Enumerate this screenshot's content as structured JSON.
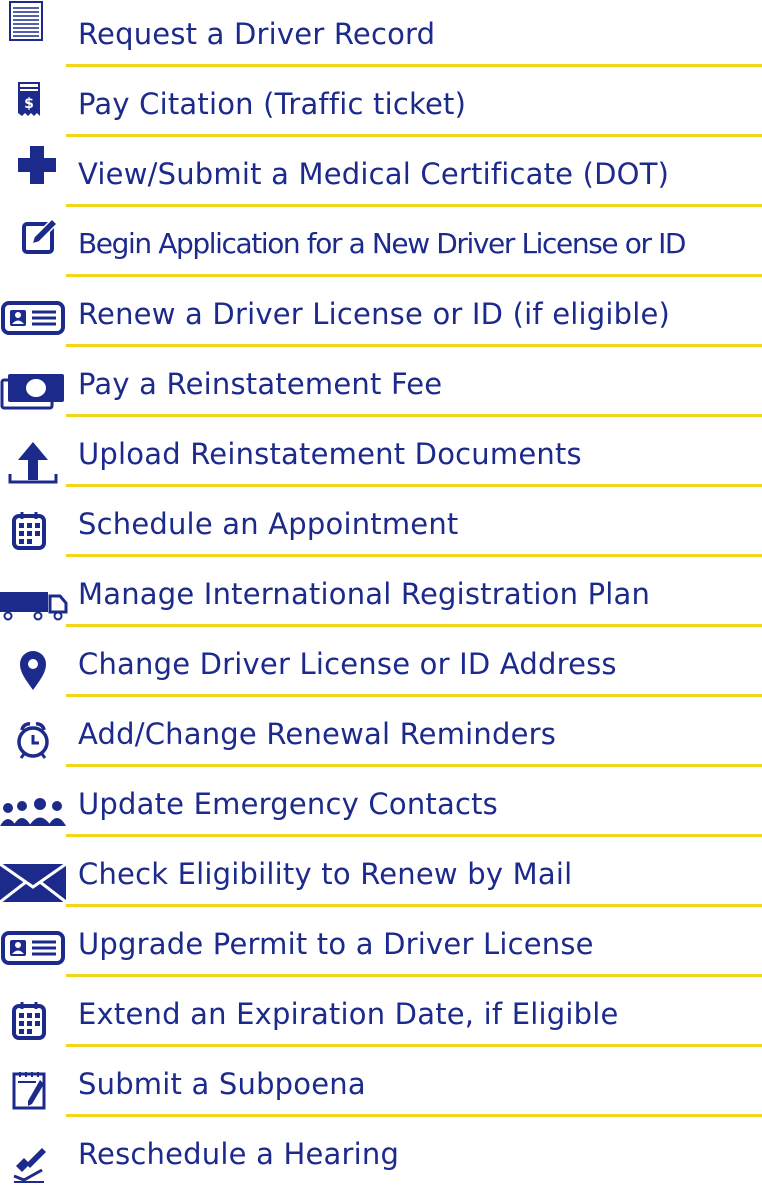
{
  "colors": {
    "text": "#1c2a8c",
    "icon": "#1c2a8c",
    "rule": "#f2d61a"
  },
  "items": [
    {
      "label": "Request a Driver Record",
      "icon": "document-lines-icon"
    },
    {
      "label": "Pay Citation (Traffic ticket)",
      "icon": "receipt-dollar-icon"
    },
    {
      "label": "View/Submit a Medical Certificate (DOT)",
      "icon": "medical-cross-icon"
    },
    {
      "label": "Begin Application for a New Driver License or ID",
      "icon": "edit-square-icon"
    },
    {
      "label": "Renew a Driver License or ID (if eligible)",
      "icon": "id-card-icon"
    },
    {
      "label": "Pay a Reinstatement Fee",
      "icon": "cash-bill-icon"
    },
    {
      "label": "Upload Reinstatement Documents",
      "icon": "upload-arrow-icon"
    },
    {
      "label": "Schedule an Appointment",
      "icon": "calendar-icon"
    },
    {
      "label": "Manage International Registration Plan",
      "icon": "truck-icon"
    },
    {
      "label": "Change Driver License or ID Address",
      "icon": "map-pin-icon"
    },
    {
      "label": "Add/Change Renewal Reminders",
      "icon": "alarm-clock-icon"
    },
    {
      "label": "Update Emergency Contacts",
      "icon": "people-group-icon"
    },
    {
      "label": "Check Eligibility to Renew by Mail",
      "icon": "envelope-icon"
    },
    {
      "label": "Upgrade Permit to a Driver License",
      "icon": "id-card-icon"
    },
    {
      "label": "Extend an Expiration Date, if Eligible",
      "icon": "calendar-icon"
    },
    {
      "label": "Submit a Subpoena",
      "icon": "notepad-pencil-icon"
    },
    {
      "label": "Reschedule a Hearing",
      "icon": "gavel-check-icon"
    }
  ]
}
